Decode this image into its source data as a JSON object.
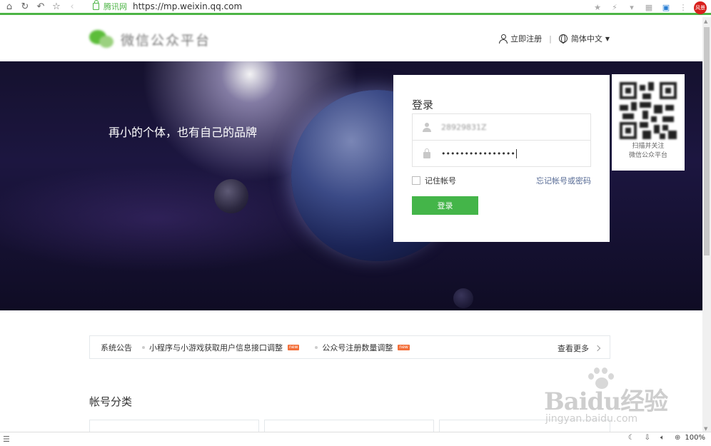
{
  "browser": {
    "site_tag": "腾讯网",
    "url": "https://mp.weixin.qq.com",
    "zoom": "100%",
    "avatar_text": "风景"
  },
  "header": {
    "logo_text": "微信公众平台",
    "register": "立即注册",
    "language": "简体中文"
  },
  "hero": {
    "slogan": "再小的个体，也有自己的品牌"
  },
  "login": {
    "title": "登录",
    "username": "28929831Z",
    "password": "••••••••••••••••",
    "remember_label": "记住帐号",
    "remember_checked": false,
    "forgot": "忘记帐号或密码",
    "submit": "登录"
  },
  "qr": {
    "caption_line1": "扫描并关注",
    "caption_line2": "微信公众平台"
  },
  "notice": {
    "label": "系统公告",
    "items": [
      {
        "text": "小程序与小游戏获取用户信息接口调整",
        "tag": "new"
      },
      {
        "text": "公众号注册数量调整",
        "tag": "new"
      }
    ],
    "more": "查看更多"
  },
  "account_section": {
    "title": "帐号分类"
  },
  "watermark": {
    "main": "Baidu经验",
    "sub": "jingyan.baidu.com"
  },
  "colors": {
    "accent_green": "#44b549",
    "link_blue": "#576b95",
    "browser_green": "#4cb445"
  }
}
